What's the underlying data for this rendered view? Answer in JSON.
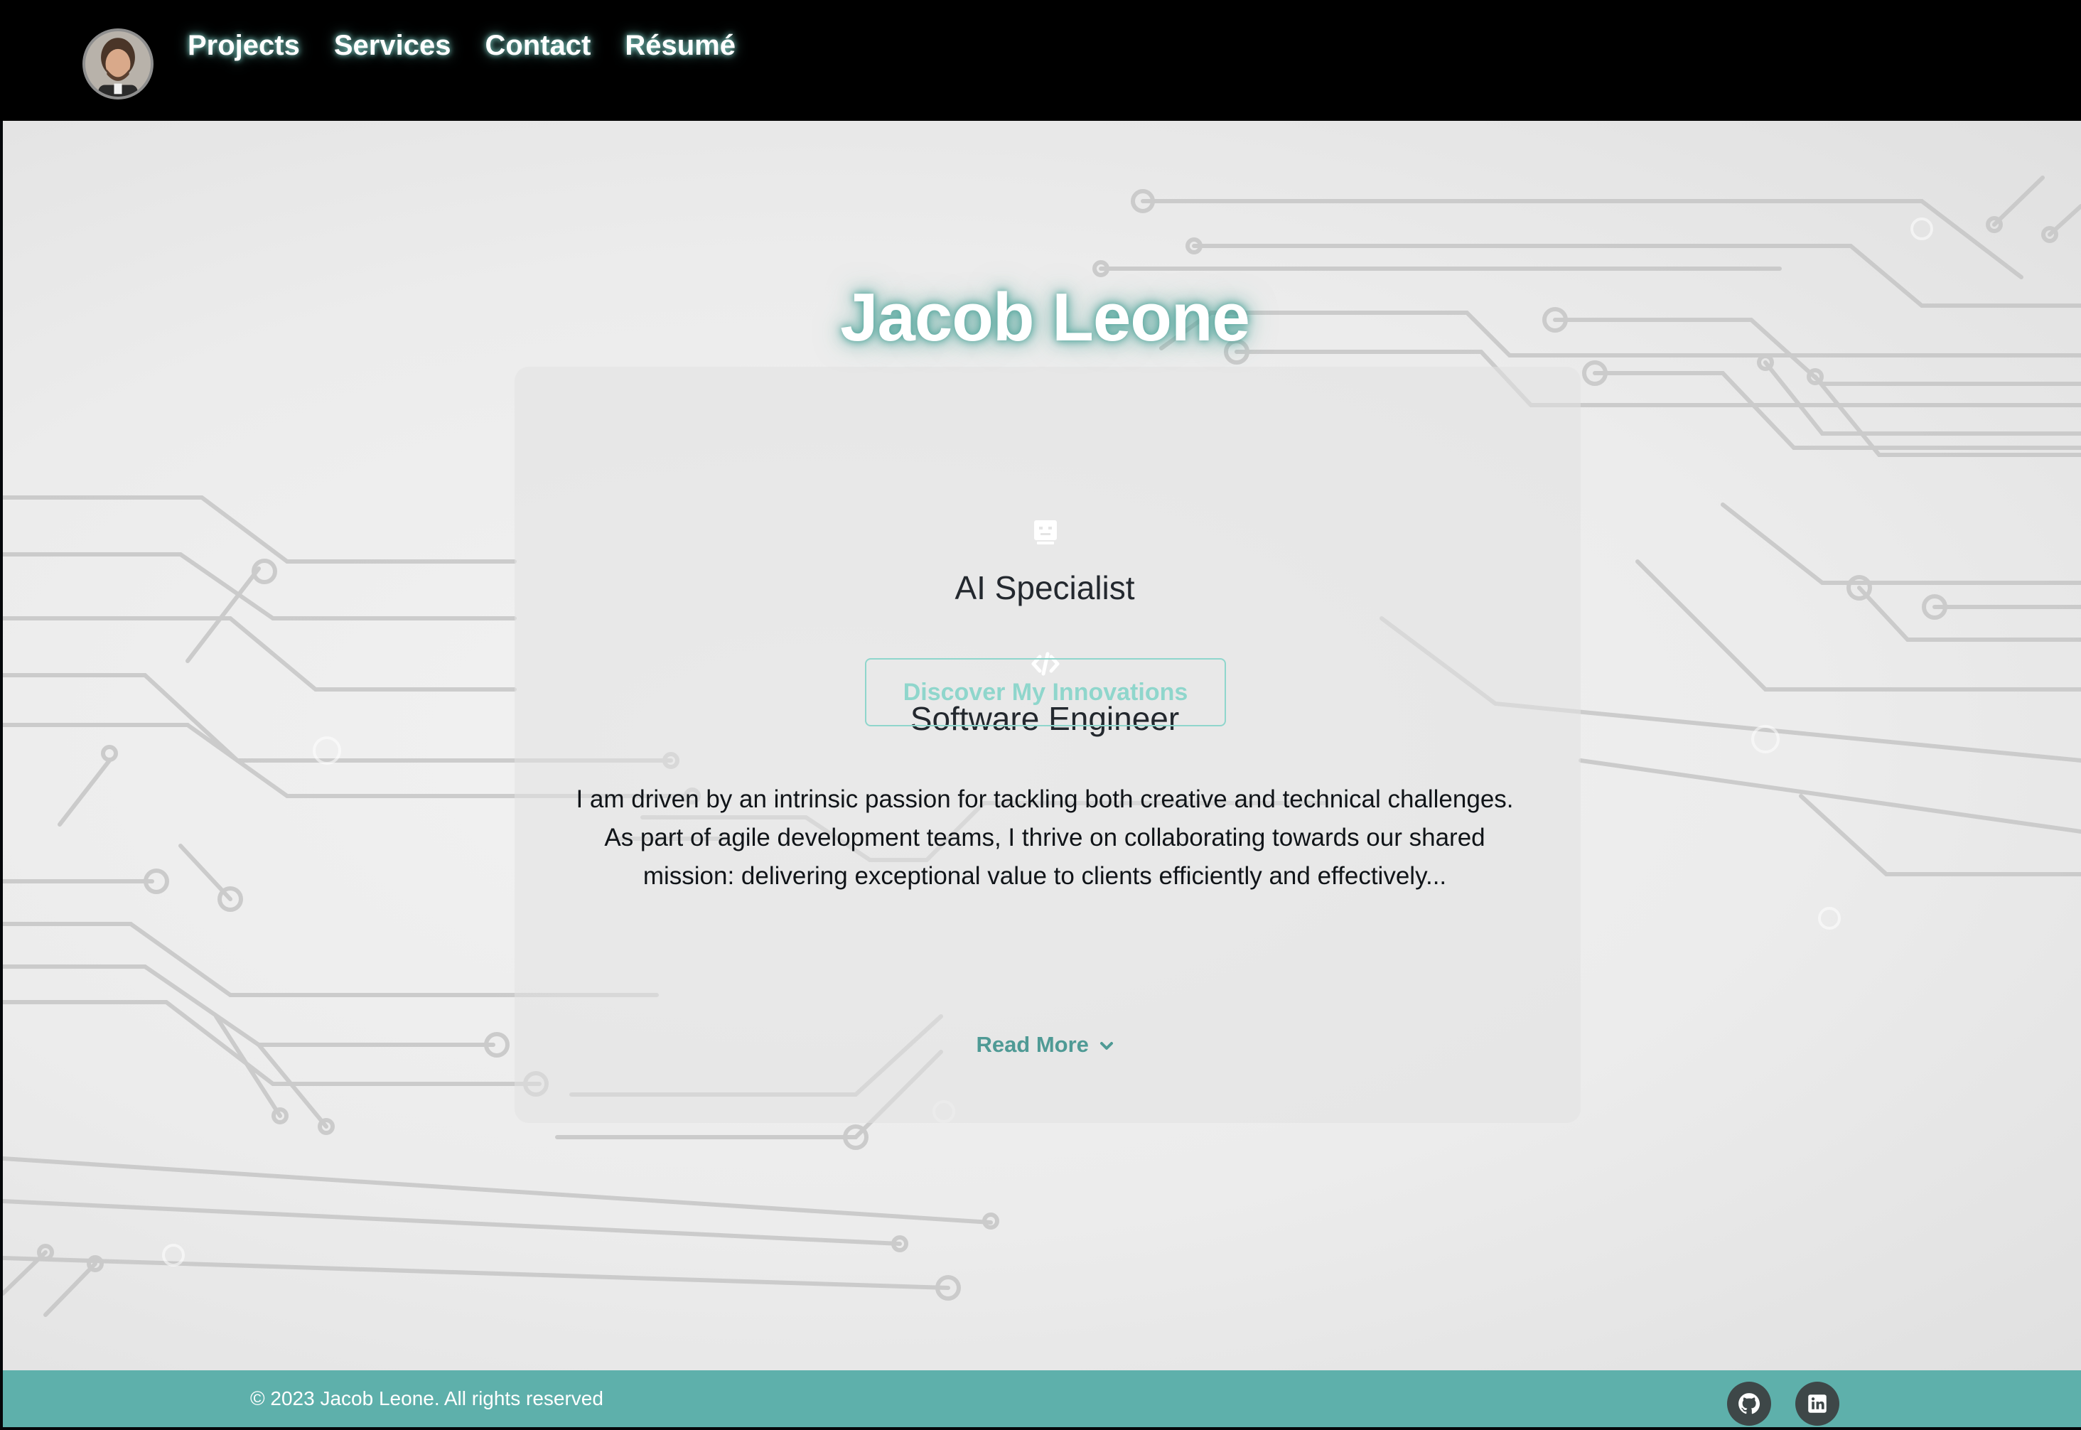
{
  "nav": {
    "avatar_alt": "Jacob Leone avatar",
    "links": [
      {
        "label": "Projects"
      },
      {
        "label": "Services"
      },
      {
        "label": "Contact"
      },
      {
        "label": "Résumé"
      }
    ]
  },
  "hero": {
    "name": "Jacob Leone",
    "roles": [
      {
        "icon": "robot-icon",
        "label": "AI Specialist"
      },
      {
        "icon": "code-icon",
        "label": "Software Engineer"
      }
    ],
    "cta_label": "Discover My Innovations",
    "bio_lines": [
      "I am driven by an intrinsic passion for tackling both creative and technical challenges.",
      "As part of agile development teams, I thrive on collaborating towards our shared",
      "mission: delivering exceptional value to clients efficiently and effectively..."
    ],
    "read_more_label": "Read More"
  },
  "footer": {
    "copyright": "© 2023 Jacob Leone. All rights reserved",
    "social": [
      {
        "icon": "github-icon"
      },
      {
        "icon": "linkedin-icon"
      }
    ]
  },
  "colors": {
    "accent": "#5eb0ab",
    "cta_text": "#8fd6cc",
    "link": "#4f9a95",
    "navbar": "#000000",
    "social_bg": "#3e4748"
  }
}
